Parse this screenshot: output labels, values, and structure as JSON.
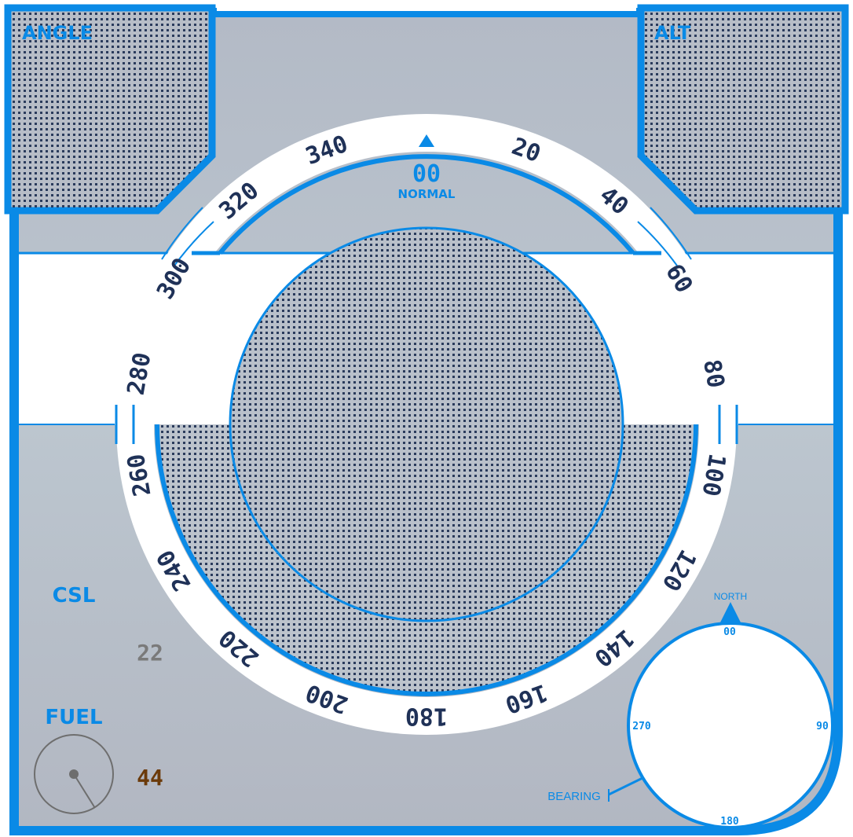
{
  "colors": {
    "frame_blue": "#0a8ae6",
    "panel_gray": "#b7bec8",
    "grid_dot": "#2a3b5c",
    "tick_navy": "#1f3157",
    "fuel_value": "#6b3a0a",
    "csl_value": "#7a7a7a"
  },
  "panels": {
    "angle_label": "ANGLE",
    "alt_label": "ALT"
  },
  "compass_ring": {
    "heading_value": "00",
    "mode_label": "NORMAL",
    "ticks": [
      {
        "label": "20",
        "angle": 20
      },
      {
        "label": "40",
        "angle": 40
      },
      {
        "label": "60",
        "angle": 60
      },
      {
        "label": "80",
        "angle": 80
      },
      {
        "label": "100",
        "angle": 100
      },
      {
        "label": "120",
        "angle": 120
      },
      {
        "label": "140",
        "angle": 140
      },
      {
        "label": "160",
        "angle": 160
      },
      {
        "label": "180",
        "angle": 180
      },
      {
        "label": "200",
        "angle": 200
      },
      {
        "label": "220",
        "angle": 220
      },
      {
        "label": "240",
        "angle": 240
      },
      {
        "label": "260",
        "angle": 260
      },
      {
        "label": "280",
        "angle": 280
      },
      {
        "label": "300",
        "angle": 300
      },
      {
        "label": "320",
        "angle": 320
      },
      {
        "label": "340",
        "angle": 340
      }
    ]
  },
  "status": {
    "csl_label": "CSL",
    "csl_value": "22",
    "fuel_label": "FUEL",
    "fuel_value": "44",
    "fuel_needle_angle_deg": 148
  },
  "mini_compass": {
    "north_label": "NORTH",
    "n_value": "00",
    "e_value": "90",
    "s_value": "180",
    "w_value": "270",
    "bearing_label": "BEARING"
  }
}
